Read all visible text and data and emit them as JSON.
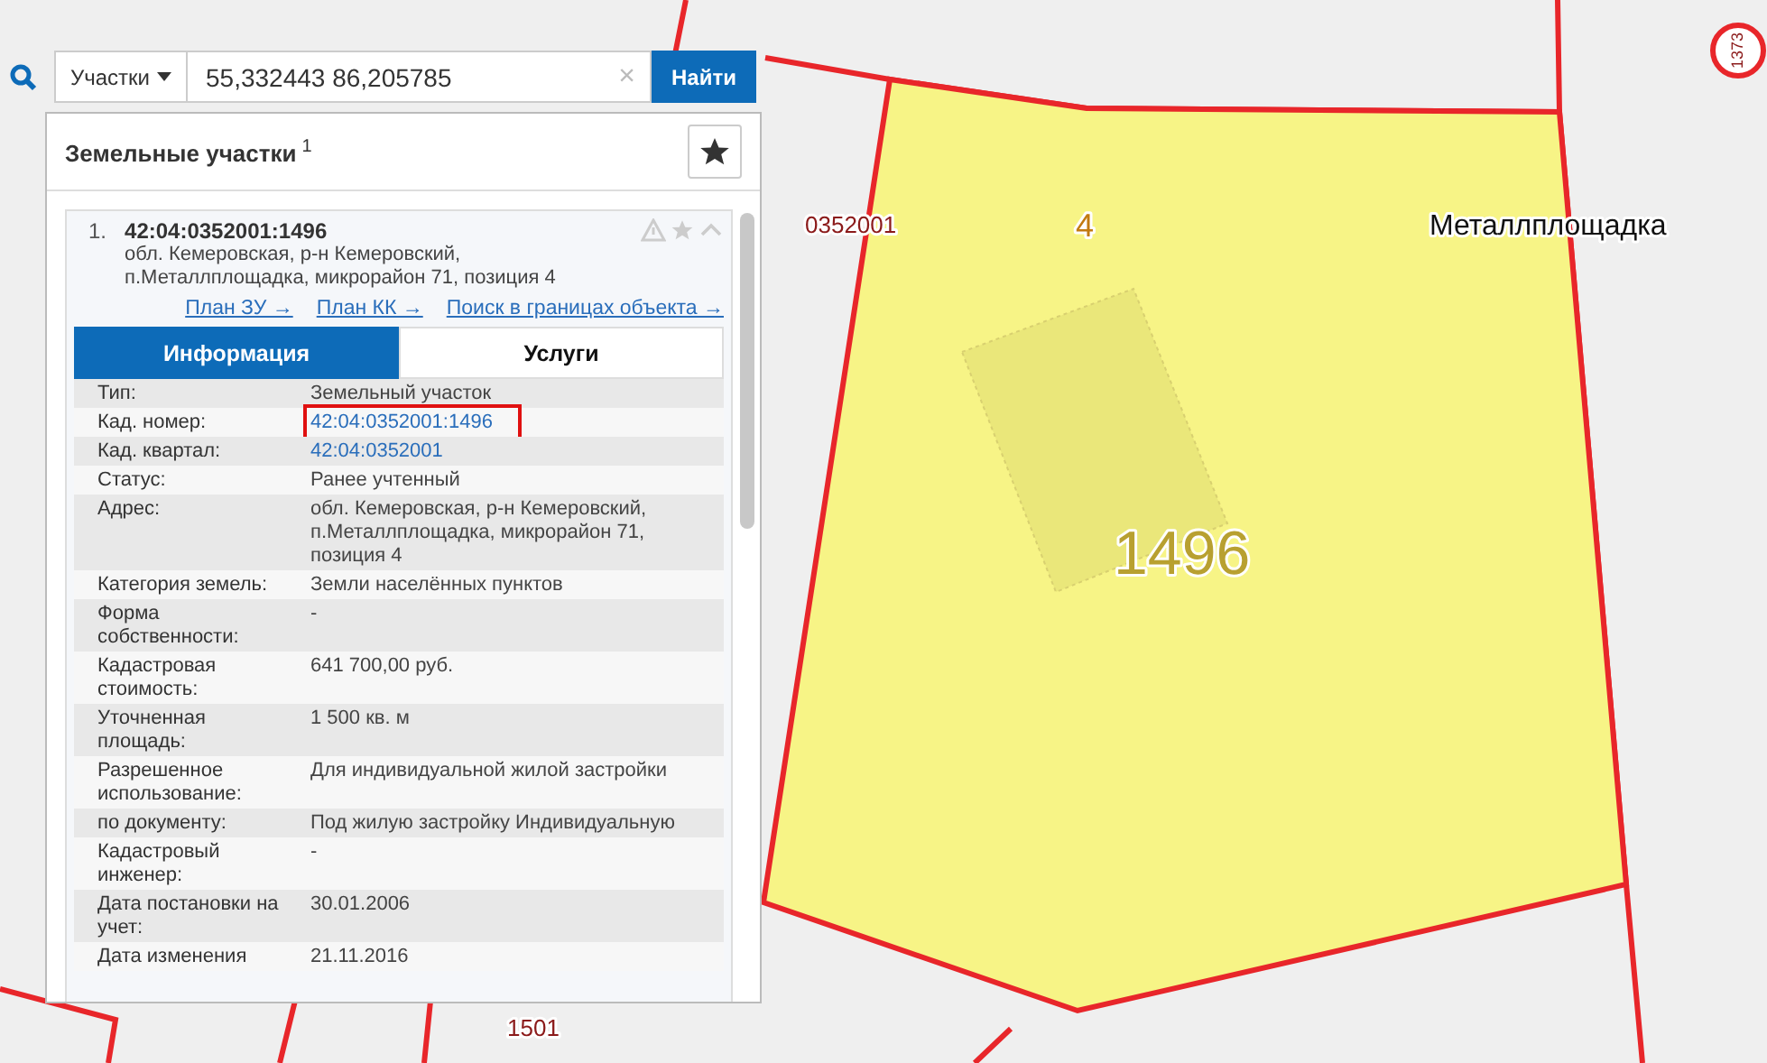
{
  "search": {
    "category": "Участки",
    "value": "55,332443 86,205785",
    "clear": "×",
    "button": "Найти"
  },
  "panel": {
    "title": "Земельные участки",
    "title_count": "1",
    "result": {
      "index": "1.",
      "number": "42:04:0352001:1496",
      "address": "обл. Кемеровская, р-н Кемеровский, п.Металлплощадка, микрорайон 71, позиция 4",
      "links": [
        "План ЗУ →",
        "План КК →",
        "Поиск в границах объекта →"
      ],
      "tabs": [
        {
          "label": "Информация",
          "selected": true
        },
        {
          "label": "Услуги",
          "selected": false
        }
      ],
      "rows": [
        {
          "label": "Тип:",
          "value": "Земельный участок",
          "kind": "text",
          "highlighted": false
        },
        {
          "label": "Кад. номер:",
          "value": "42:04:0352001:1496",
          "kind": "link",
          "highlighted": true
        },
        {
          "label": "Кад. квартал:",
          "value": "42:04:0352001",
          "kind": "link",
          "highlighted": false
        },
        {
          "label": "Статус:",
          "value": "Ранее учтенный",
          "kind": "text",
          "highlighted": false
        },
        {
          "label": "Адрес:",
          "value": "обл. Кемеровская, р-н Кемеровский, п.Металлплощадка, микрорайон 71, позиция 4",
          "kind": "text",
          "highlighted": false
        },
        {
          "label": "Категория земель:",
          "value": "Земли населённых пунктов",
          "kind": "text",
          "highlighted": false
        },
        {
          "label": "Форма собственности:",
          "value": "-",
          "kind": "text",
          "highlighted": false
        },
        {
          "label": "Кадастровая стоимость:",
          "value": "641 700,00 руб.",
          "kind": "text",
          "highlighted": false
        },
        {
          "label": "Уточненная площадь:",
          "value": "1 500 кв. м",
          "kind": "text",
          "highlighted": false
        },
        {
          "label": "Разрешенное использование:",
          "value": "Для индивидуальной жилой застройки",
          "kind": "text",
          "highlighted": false
        },
        {
          "label": "по документу:",
          "value": "Под жилую застройку Индивидуальную",
          "kind": "text",
          "highlighted": false
        },
        {
          "label": "Кадастровый инженер:",
          "value": "-",
          "kind": "text",
          "highlighted": false
        },
        {
          "label": "Дата постановки на учет:",
          "value": "30.01.2006",
          "kind": "text",
          "highlighted": false
        },
        {
          "label": "Дата изменения",
          "value": "21.11.2016",
          "kind": "text",
          "highlighted": false
        }
      ]
    }
  },
  "map_labels": [
    {
      "text": "0352001",
      "kind": "quarter"
    },
    {
      "text": "4",
      "kind": "number"
    },
    {
      "text": "Металлплощадка",
      "kind": "place"
    },
    {
      "text": "1496",
      "kind": "parcel"
    },
    {
      "text": "1501",
      "kind": "quarter"
    },
    {
      "text": "1373",
      "kind": "ring"
    }
  ]
}
